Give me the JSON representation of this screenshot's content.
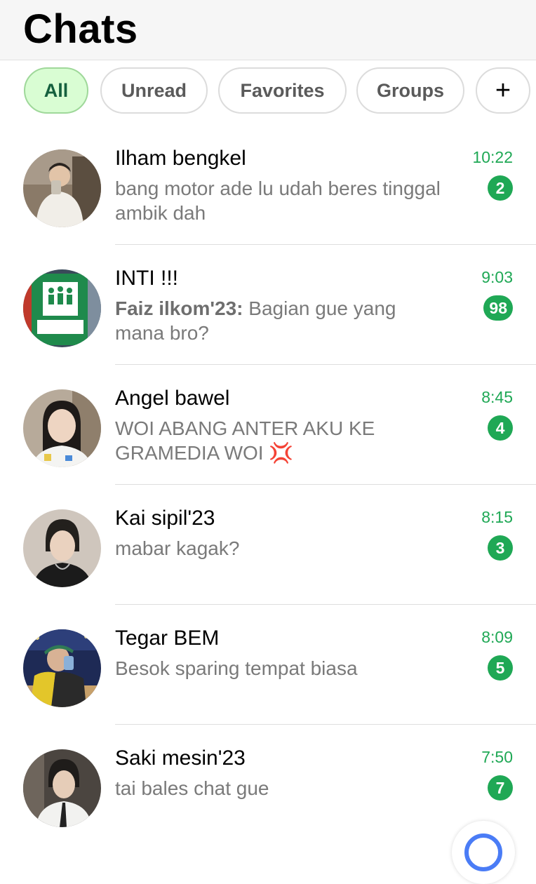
{
  "header": {
    "title": "Chats"
  },
  "filters": [
    {
      "label": "All",
      "active": true
    },
    {
      "label": "Unread",
      "active": false
    },
    {
      "label": "Favorites",
      "active": false
    },
    {
      "label": "Groups",
      "active": false
    },
    {
      "label": "+",
      "active": false
    }
  ],
  "chats": [
    {
      "name": "Ilham bengkel",
      "sender": "",
      "message": "bang motor ade lu udah beres tinggal ambik dah",
      "time": "10:22",
      "unread": "2",
      "avatar": "person-photo"
    },
    {
      "name": "INTI !!!",
      "sender": "Faiz ilkom'23:",
      "message": " Bagian gue yang mana bro?",
      "time": "9:03",
      "unread": "98",
      "avatar": "assembly-point-sign"
    },
    {
      "name": "Angel bawel",
      "sender": "",
      "message": "WOI ABANG ANTER AKU KE GRAMEDIA WOI 💢",
      "time": "8:45",
      "unread": "4",
      "avatar": "person-photo"
    },
    {
      "name": "Kai sipil'23",
      "sender": "",
      "message": "mabar kagak?",
      "time": "8:15",
      "unread": "3",
      "avatar": "person-photo"
    },
    {
      "name": "Tegar BEM",
      "sender": "",
      "message": "Besok sparing tempat biasa",
      "time": "8:09",
      "unread": "5",
      "avatar": "person-photo"
    },
    {
      "name": "Saki mesin'23",
      "sender": "",
      "message": "tai bales chat gue",
      "time": "7:50",
      "unread": "7",
      "avatar": "person-photo"
    }
  ],
  "colors": {
    "accent": "#1fa855",
    "active_pill_bg": "#d9fdd3",
    "header_bg": "#f6f6f6"
  }
}
